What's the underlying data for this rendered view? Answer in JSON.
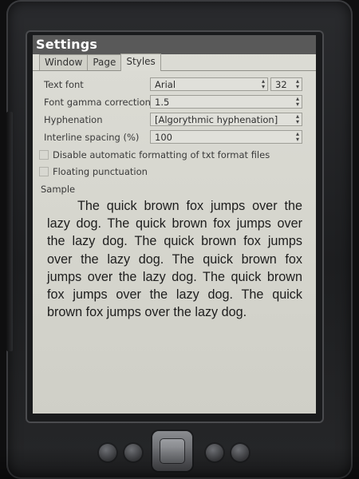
{
  "window": {
    "title": "Settings"
  },
  "tabs": [
    {
      "label": "Window",
      "active": false
    },
    {
      "label": "Page",
      "active": false
    },
    {
      "label": "Styles",
      "active": true
    }
  ],
  "settings": {
    "text_font": {
      "label": "Text font",
      "value": "Arial",
      "size": "32"
    },
    "font_gamma": {
      "label": "Font gamma correction",
      "value": "1.5"
    },
    "hyphenation": {
      "label": "Hyphenation",
      "value": "[Algorythmic hyphenation]"
    },
    "interline": {
      "label": "Interline spacing (%)",
      "value": "100"
    },
    "checkboxes": [
      {
        "label": "Disable automatic formatting of txt format files",
        "checked": false
      },
      {
        "label": "Floating punctuation",
        "checked": false
      }
    ]
  },
  "sample": {
    "label": "Sample",
    "text": "The quick brown fox jumps over the lazy dog. The quick brown fox jumps over the lazy dog. The quick brown fox jumps over the lazy dog. The quick brown fox jumps over the lazy dog. The quick brown fox jumps over the lazy dog. The quick brown fox jumps over the lazy dog."
  },
  "icons": {
    "spin_up": "▴",
    "spin_down": "▾"
  },
  "colors": {
    "titlebar_bg": "#595959",
    "screen_bg": "#dcdcd5",
    "device_bg": "#1f2022"
  }
}
